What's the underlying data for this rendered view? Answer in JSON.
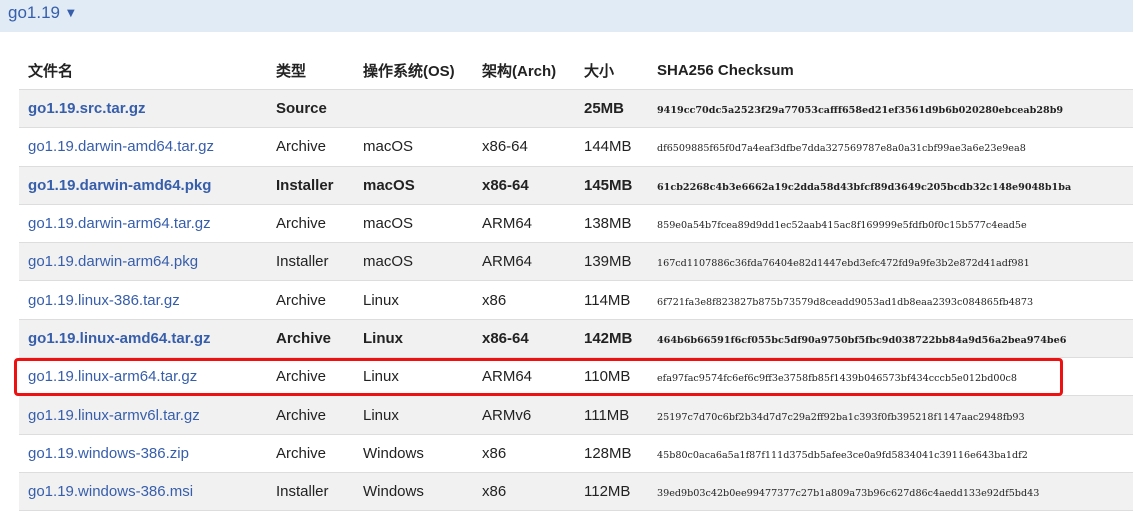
{
  "version_header": {
    "label": "go1.19",
    "toggle_icon": "caret-down-icon"
  },
  "table": {
    "columns": {
      "filename": "文件名",
      "kind": "类型",
      "os": "操作系统(OS)",
      "arch": "架构(Arch)",
      "size": "大小",
      "checksum": "SHA256 Checksum"
    },
    "rows": [
      {
        "filename": "go1.19.src.tar.gz",
        "kind": "Source",
        "os": "",
        "arch": "",
        "size": "25MB",
        "checksum": "9419cc70dc5a2523f29a77053cafff658ed21ef3561d9b6b020280ebceab28b9",
        "highlight": true
      },
      {
        "filename": "go1.19.darwin-amd64.tar.gz",
        "kind": "Archive",
        "os": "macOS",
        "arch": "x86-64",
        "size": "144MB",
        "checksum": "df6509885f65f0d7a4eaf3dfbe7dda327569787e8a0a31cbf99ae3a6e23e9ea8",
        "highlight": false
      },
      {
        "filename": "go1.19.darwin-amd64.pkg",
        "kind": "Installer",
        "os": "macOS",
        "arch": "x86-64",
        "size": "145MB",
        "checksum": "61cb2268c4b3e6662a19c2dda58d43bfcf89d3649c205bcdb32c148e9048b1ba",
        "highlight": true
      },
      {
        "filename": "go1.19.darwin-arm64.tar.gz",
        "kind": "Archive",
        "os": "macOS",
        "arch": "ARM64",
        "size": "138MB",
        "checksum": "859e0a54b7fcea89d9dd1ec52aab415ac8f169999e5fdfb0f0c15b577c4ead5e",
        "highlight": false
      },
      {
        "filename": "go1.19.darwin-arm64.pkg",
        "kind": "Installer",
        "os": "macOS",
        "arch": "ARM64",
        "size": "139MB",
        "checksum": "167cd1107886c36fda76404e82d1447ebd3efc472fd9a9fe3b2e872d41adf981",
        "highlight": false
      },
      {
        "filename": "go1.19.linux-386.tar.gz",
        "kind": "Archive",
        "os": "Linux",
        "arch": "x86",
        "size": "114MB",
        "checksum": "6f721fa3e8f823827b875b73579d8ceadd9053ad1db8eaa2393c084865fb4873",
        "highlight": false
      },
      {
        "filename": "go1.19.linux-amd64.tar.gz",
        "kind": "Archive",
        "os": "Linux",
        "arch": "x86-64",
        "size": "142MB",
        "checksum": "464b6b66591f6cf055bc5df90a9750bf5fbc9d038722bb84a9d56a2bea974be6",
        "highlight": true
      },
      {
        "filename": "go1.19.linux-arm64.tar.gz",
        "kind": "Archive",
        "os": "Linux",
        "arch": "ARM64",
        "size": "110MB",
        "checksum": "efa97fac9574fc6ef6c9ff3e3758fb85f1439b046573bf434cccb5e012bd00c8",
        "highlight": false
      },
      {
        "filename": "go1.19.linux-armv6l.tar.gz",
        "kind": "Archive",
        "os": "Linux",
        "arch": "ARMv6",
        "size": "111MB",
        "checksum": "25197c7d70c6bf2b34d7d7c29a2ff92ba1c393f0fb395218f1147aac2948fb93",
        "highlight": false
      },
      {
        "filename": "go1.19.windows-386.zip",
        "kind": "Archive",
        "os": "Windows",
        "arch": "x86",
        "size": "128MB",
        "checksum": "45b80c0aca6a5a1f87f111d375db5afee3ce0a9fd5834041c39116e643ba1df2",
        "highlight": false
      },
      {
        "filename": "go1.19.windows-386.msi",
        "kind": "Installer",
        "os": "Windows",
        "arch": "x86",
        "size": "112MB",
        "checksum": "39ed9b03c42b0ee99477377c27b1a809a73b96c627d86c4aedd133e92df5bd43",
        "highlight": false
      }
    ]
  },
  "selection": {
    "row_index": 7,
    "color": "#ee1111"
  },
  "colors": {
    "link": "#375eab",
    "header_bar": "#e0ebf5",
    "row_stripe": "#f1f1f1"
  }
}
